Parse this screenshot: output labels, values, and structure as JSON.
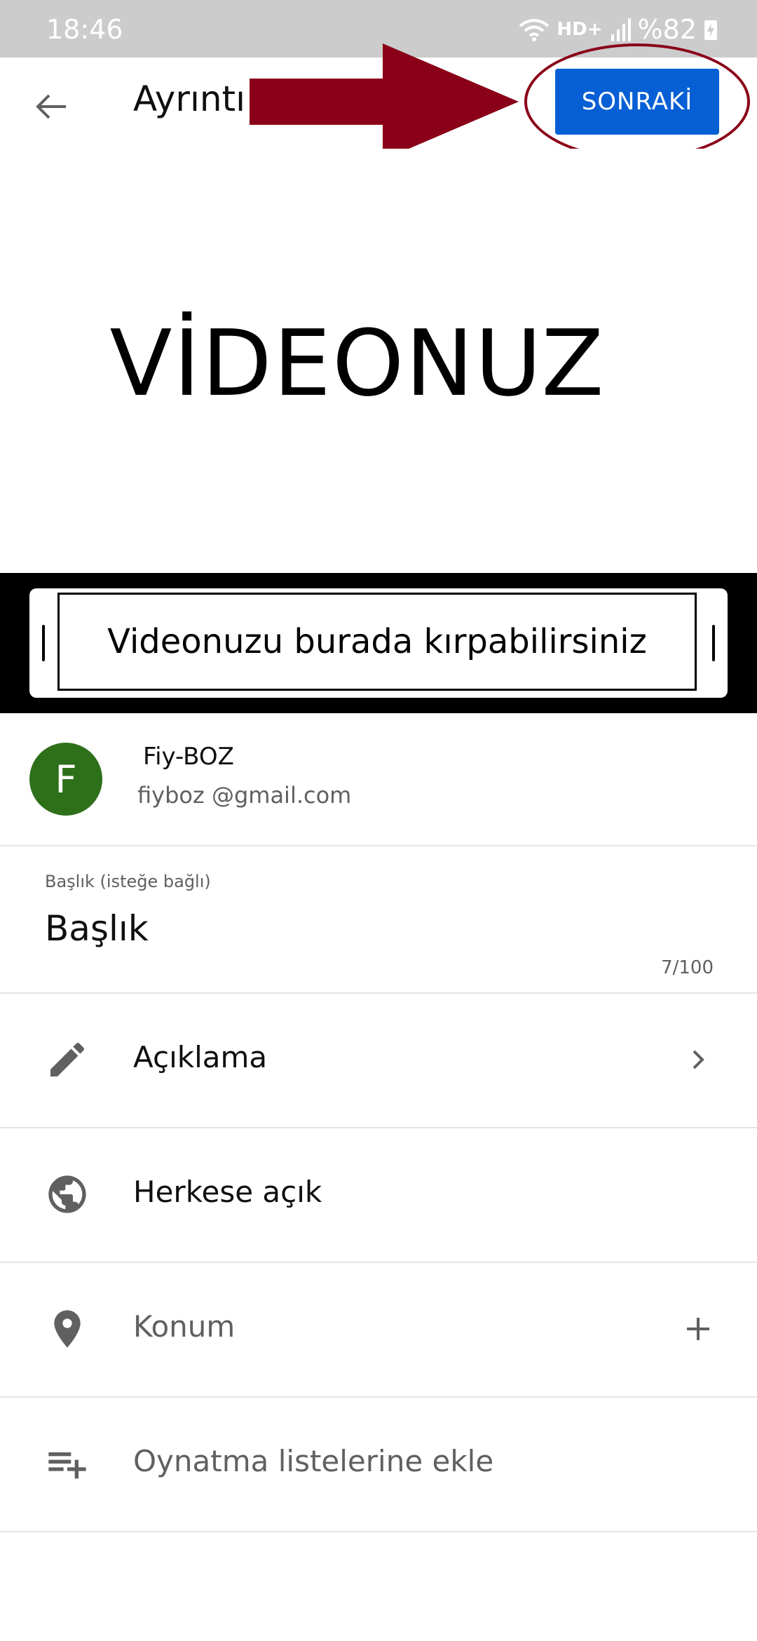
{
  "status_bar": {
    "time": "18:46",
    "network": "HD+",
    "battery": "%82"
  },
  "app_bar": {
    "title": "Ayrıntı",
    "next_label": "SONRAKİ"
  },
  "preview": {
    "text": "VİDEONUZ"
  },
  "trim": {
    "text": "Videonuzu burada kırpabilirsiniz"
  },
  "account": {
    "initial": "F",
    "name": "Fiy-BOZ",
    "email": "fiyboz @gmail.com"
  },
  "title_field": {
    "label": "Başlık (isteğe bağlı)",
    "value": "Başlık",
    "counter": "7/100"
  },
  "rows": [
    {
      "label": "Açıklama",
      "icon": "pencil-icon"
    },
    {
      "label": "Herkese açık",
      "icon": "globe-icon"
    },
    {
      "label": "Konum",
      "icon": "location-pin-icon"
    },
    {
      "label": "Oynatma listelerine ekle",
      "icon": "playlist-add-icon"
    }
  ],
  "colors": {
    "accent": "#065fd4",
    "annotation": "#8a0018",
    "avatar": "#2e6f1a"
  }
}
